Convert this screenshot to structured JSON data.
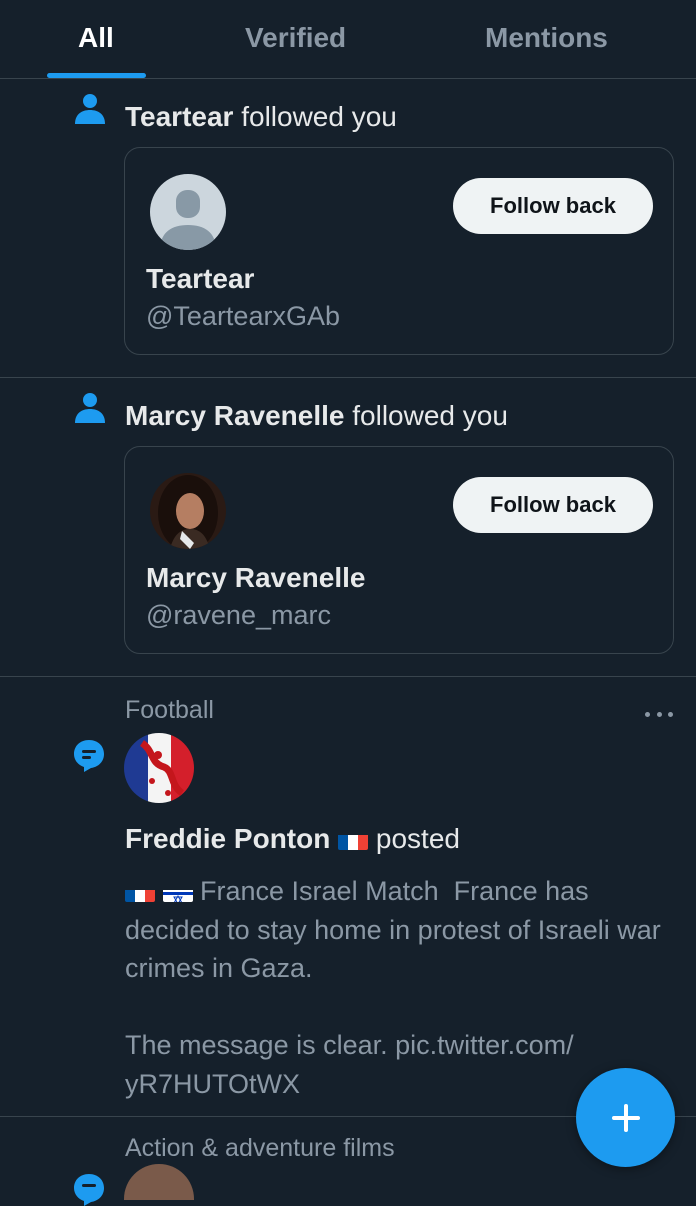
{
  "tabs": [
    {
      "label": "All",
      "active": true
    },
    {
      "label": "Verified",
      "active": false
    },
    {
      "label": "Mentions",
      "active": false
    }
  ],
  "notifications": [
    {
      "type": "follow",
      "icon": "person-icon",
      "actor": "Teartear",
      "action": " followed you",
      "card": {
        "name": "Teartear",
        "handle": "@TeartearxGAb",
        "button": "Follow back",
        "avatar": "default-avatar-icon"
      }
    },
    {
      "type": "follow",
      "icon": "person-icon",
      "actor": "Marcy Ravenelle",
      "action": " followed you",
      "card": {
        "name": "Marcy Ravenelle",
        "handle": "@ravene_marc",
        "button": "Follow back",
        "avatar": "profile-photo"
      }
    }
  ],
  "post": {
    "topic": "Football",
    "icon": "speech-bubble-icon",
    "author": "Freddie Ponton",
    "author_flag": "france-flag-icon",
    "action": "posted",
    "text_lead_flags": [
      "france-flag-icon",
      "israel-flag-icon"
    ],
    "text_line1": " France Israel Match  France has decided to stay home in protest of Israeli war crimes in Gaza.",
    "text_rest": "The message is clear. pic.twitter.com/\nyR7HUTOtWX"
  },
  "next_topic": "Action & adventure films",
  "fab": {
    "icon": "plus-icon"
  },
  "colors": {
    "background": "#15202b",
    "accent": "#1d9bf0",
    "muted": "#8b98a5",
    "border": "#38444d",
    "button_bg": "#eff3f4"
  }
}
